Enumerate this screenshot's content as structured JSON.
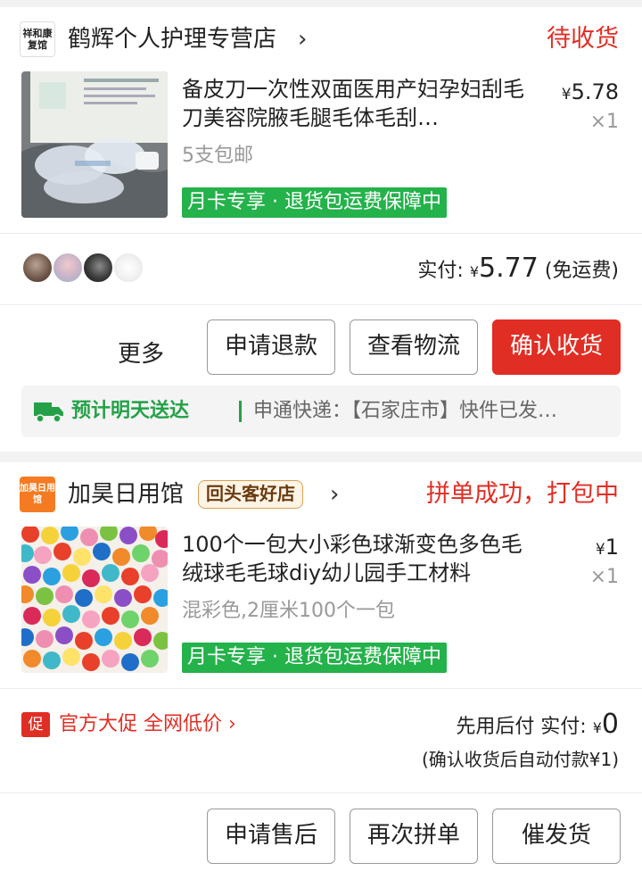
{
  "orders": [
    {
      "store": {
        "logo_text": "祥和康复馆",
        "name": "鹤辉个人护理专营店",
        "chevron": "›"
      },
      "status": "待收货",
      "item": {
        "title": "备皮刀一次性双面医用产妇孕妇刮毛刀美容院腋毛腿毛体毛刮…",
        "currency": "¥",
        "price": "5.78",
        "quantity": "×1",
        "spec": "5支包邮",
        "tag": "月卡专享 · 退货包运费保障中",
        "image_icon": "razor-package-photo"
      },
      "paid": {
        "label": "实付:",
        "currency": "¥",
        "amount": "5.77",
        "note": "(免运费)"
      },
      "actions": {
        "more": "更多",
        "refund": "申请退款",
        "logistics": "查看物流",
        "confirm": "确认收货"
      },
      "logistics": {
        "eta": "预计明天送达",
        "text": "申通快递：【石家庄市】快件已发…",
        "icon": "truck-icon"
      }
    },
    {
      "store": {
        "logo_text": "加昊日用馆",
        "name": "加昊日用馆",
        "badge": "回头客好店",
        "chevron": "›"
      },
      "status": "拼单成功，打包中",
      "item": {
        "title": "100个一包大小彩色球渐变色多色毛绒球毛毛球diy幼儿园手工材料",
        "currency": "¥",
        "price": "1",
        "quantity": "×1",
        "spec": "混彩色,2厘米100个一包",
        "tag": "月卡专享 · 退货包运费保障中",
        "image_icon": "colorful-pompoms-photo"
      },
      "promo": {
        "icon_text": "促",
        "text": "官方大促 全网低价 ›"
      },
      "paid": {
        "label": "先用后付  实付:",
        "currency": "¥",
        "amount": "0",
        "auto_pay": "(确认收货后自动付款¥1)"
      },
      "actions": {
        "after_sale": "申请售后",
        "reorder": "再次拼单",
        "urge": "催发货"
      }
    }
  ],
  "colors": {
    "accent_red": "#e02e24",
    "green": "#24b24b"
  }
}
